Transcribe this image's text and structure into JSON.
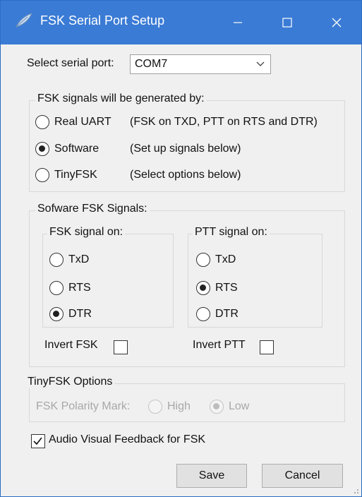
{
  "window": {
    "title": "FSK Serial Port Setup"
  },
  "port": {
    "label": "Select serial port:",
    "value": "COM7"
  },
  "gen_group": {
    "legend": "FSK signals will be generated by:",
    "options": [
      {
        "label": "Real UART",
        "note": "(FSK on TXD, PTT on RTS and DTR)",
        "checked": false
      },
      {
        "label": "Software",
        "note": "(Set up signals below)",
        "checked": true
      },
      {
        "label": "TinyFSK",
        "note": "(Select options below)",
        "checked": false
      }
    ]
  },
  "sw_group": {
    "legend": "Sofware FSK Signals:",
    "fsk": {
      "legend": "FSK signal on:",
      "options": [
        "TxD",
        "RTS",
        "DTR"
      ],
      "selected": "DTR"
    },
    "ptt": {
      "legend": "PTT signal on:",
      "options": [
        "TxD",
        "RTS",
        "DTR"
      ],
      "selected": "RTS"
    },
    "invert_fsk_label": "Invert FSK",
    "invert_ptt_label": "Invert PTT"
  },
  "tiny_group": {
    "legend": "TinyFSK Options",
    "polarity_label": "FSK Polarity Mark:",
    "high_label": "High",
    "low_label": "Low",
    "selected": "Low"
  },
  "feedback": {
    "label": "Audio Visual Feedback for FSK",
    "checked": true
  },
  "buttons": {
    "save": "Save",
    "cancel": "Cancel"
  },
  "colors": {
    "titlebar": "#3a7bd5",
    "window_bg": "#f0f0f0"
  }
}
